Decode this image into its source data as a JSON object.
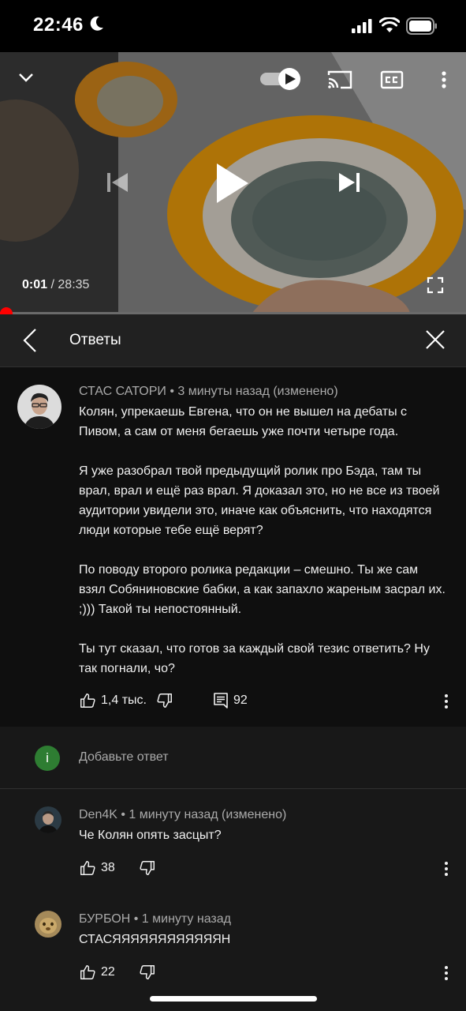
{
  "status_bar": {
    "time": "22:46"
  },
  "player": {
    "current_time": "0:01",
    "separator": "/",
    "duration": "28:35",
    "progress_fraction": 0.0006
  },
  "replies_panel": {
    "title": "Ответы"
  },
  "main_comment": {
    "author": "СТАС САТОРИ",
    "meta": " • 3 минуты назад (изменено)",
    "paragraphs": [
      "Колян, упрекаешь Евгена, что он не вышел на дебаты с Пивом, а сам от меня бегаешь уже почти четыре года.",
      "Я уже разобрал твой предыдущий ролик про Бэда, там ты врал, врал и ещё раз врал. Я доказал это, но не все из твоей аудитории увидели это, иначе как объяснить, что находятся люди которые тебе ещё верят?",
      "По поводу второго ролика редакции – смешно. Ты же сам взял Собяниновские бабки, а как запахло жареным засрал их. ;))) Такой ты непостоянный.",
      "Ты тут сказал, что готов за каждый свой тезис ответить? Ну так погнали, чо?"
    ],
    "likes": "1,4 тыс.",
    "replies_count": "92"
  },
  "add_reply": {
    "avatar_letter": "i",
    "placeholder": "Добавьте ответ"
  },
  "replies": [
    {
      "author": "Den4K",
      "meta": " • 1 минуту назад (изменено)",
      "text": "Че Колян опять засцыт?",
      "likes": "38"
    },
    {
      "author": "БУРБОН",
      "meta": " • 1 минуту назад",
      "text": "СТАСЯЯЯЯЯЯЯЯЯЯЯЯН",
      "likes": "22"
    }
  ],
  "colors": {
    "background": "#0f0f0f",
    "accent_red": "#ff0000",
    "secondary_text": "#aaaaaa",
    "add_reply_avatar": "#2e7d32"
  }
}
